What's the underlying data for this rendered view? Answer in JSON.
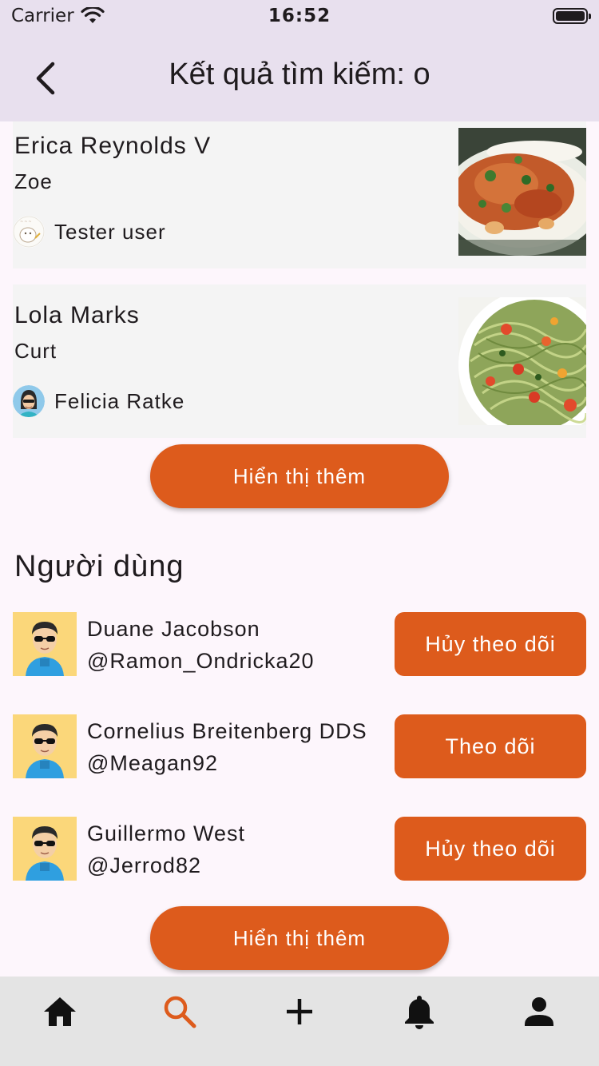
{
  "status_bar": {
    "carrier": "Carrier",
    "time": "16:52"
  },
  "header": {
    "title": "Kết quả tìm kiếm: o"
  },
  "recipes": [
    {
      "name": "Erica Reynolds V",
      "subtitle": "Zoe",
      "author": "Tester user",
      "image": "curry-dish"
    },
    {
      "name": "Lola Marks",
      "subtitle": "Curt",
      "author": "Felicia Ratke",
      "image": "pesto-pasta"
    }
  ],
  "recipes_more_label": "Hiển thị thêm",
  "users_section_title": "Người dùng",
  "users": [
    {
      "name": "Duane Jacobson",
      "handle": "@Ramon_Ondricka20",
      "button": "Hủy theo dõi"
    },
    {
      "name": "Cornelius Breitenberg DDS",
      "handle": "@Meagan92",
      "button": "Theo dõi"
    },
    {
      "name": "Guillermo West",
      "handle": "@Jerrod82",
      "button": "Hủy theo dõi"
    }
  ],
  "users_more_label": "Hiển thị thêm",
  "nav": {
    "items": [
      "home-icon",
      "search-icon",
      "add-icon",
      "bell-icon",
      "person-icon"
    ],
    "active": "search-icon"
  },
  "colors": {
    "accent": "#dd5b1c",
    "header_bg": "#e8e0ee",
    "page_bg": "#fdf6fc",
    "card_bg": "#f4f4f4",
    "nav_bg": "#e4e4e4"
  }
}
